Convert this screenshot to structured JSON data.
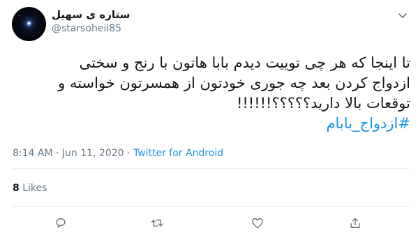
{
  "user": {
    "display_name": "ستاره ی سهیل",
    "handle": "@starsoheil85"
  },
  "tweet": {
    "lines": [
      "تا اینجا که هر چی توییت دیدم بابا هاتون با رنج و سختی",
      "ازدواج کردن بعد چه جوری خودتون از همسرتون خواسته و",
      "توقعات بالا دارید؟؟؟؟؟!!!!!!"
    ],
    "hashtag": "#ازدواج_بابام"
  },
  "meta": {
    "time": "8:14 AM",
    "separator": " · ",
    "date": "Jun 11, 2020",
    "source": "Twitter for Android"
  },
  "stats": {
    "likes_count": "8",
    "likes_label": "Likes"
  },
  "colors": {
    "text": "#14171a",
    "secondary": "#657786",
    "link": "#1b95e0",
    "divider": "#e6ecf0"
  },
  "icons": {
    "caret": "chevron-down-icon",
    "reply": "reply-icon",
    "retweet": "retweet-icon",
    "like": "heart-icon",
    "share": "share-icon"
  }
}
